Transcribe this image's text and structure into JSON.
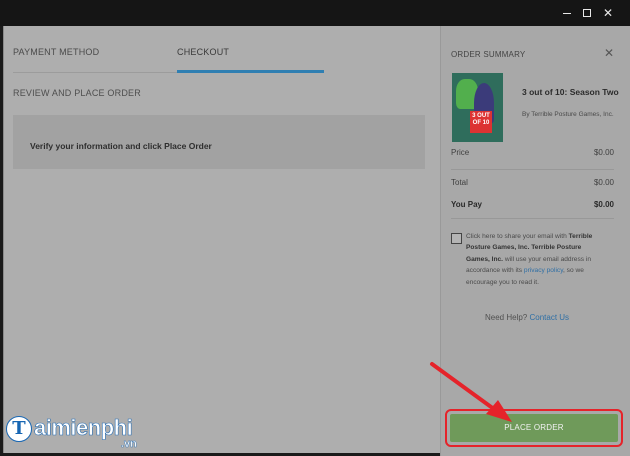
{
  "window": {
    "minimize_icon": "minimize-icon",
    "maximize_icon": "maximize-icon",
    "close_icon": "close-icon"
  },
  "tabs": [
    {
      "label": "PAYMENT METHOD",
      "active": false
    },
    {
      "label": "CHECKOUT",
      "active": true
    }
  ],
  "review": {
    "heading": "REVIEW AND PLACE ORDER",
    "message": "Verify your information and click Place Order"
  },
  "summary": {
    "title": "ORDER SUMMARY",
    "close_icon": "close-icon",
    "product": {
      "name": "3 out of 10: Season Two",
      "publisher": "By Terrible Posture Games, Inc.",
      "cover_text": "3 OUT OF 10"
    },
    "price_label": "Price",
    "price_value": "$0.00",
    "total_label": "Total",
    "total_value": "$0.00",
    "pay_label": "You Pay",
    "pay_value": "$0.00",
    "consent": {
      "part1": "Click here to share your email with",
      "bold1": "Terrible Posture Games, Inc.",
      "bold2": "Terrible Posture Games, Inc.",
      "part2": "will use your email address in accordance with its",
      "link": "privacy policy",
      "part3": ", so we encourage you to read it."
    },
    "help_text": "Need Help?",
    "help_link": "Contact Us",
    "place_order_label": "PLACE ORDER"
  },
  "colors": {
    "accent": "#2f7fb2",
    "button": "#6f9a5a",
    "highlight": "#e5232a"
  },
  "watermark": {
    "letter": "T",
    "word": "aimienphi",
    "suffix": ".vn"
  }
}
